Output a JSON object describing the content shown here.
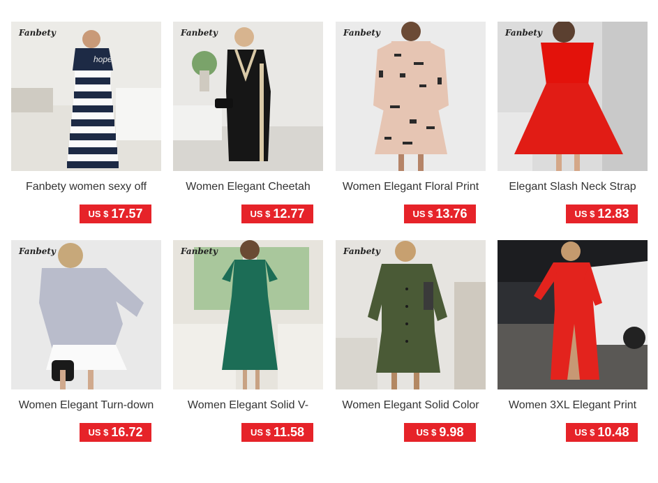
{
  "products": [
    {
      "brand": "Fanbety",
      "title": "Fanbety women sexy off",
      "currency": "US $",
      "price": "17.57",
      "image": "navy-striped-anchor-dress"
    },
    {
      "brand": "Fanbety",
      "title": "Women Elegant Cheetah",
      "currency": "US $",
      "price": "12.77",
      "image": "black-vneck-bodycon-dress"
    },
    {
      "brand": "Fanbety",
      "title": "Women Elegant Floral Print",
      "currency": "US $",
      "price": "13.76",
      "image": "letter-print-pink-dress"
    },
    {
      "brand": "Fanbety",
      "title": "Elegant Slash Neck Strap",
      "currency": "US $",
      "price": "12.83",
      "image": "red-off-shoulder-dress"
    },
    {
      "brand": "Fanbety",
      "title": "Women Elegant Turn-down",
      "currency": "US $",
      "price": "16.72",
      "image": "grey-sweatshirt-dress"
    },
    {
      "brand": "Fanbety",
      "title": "Women Elegant Solid V-",
      "currency": "US $",
      "price": "11.58",
      "image": "green-vneck-maxi-dress"
    },
    {
      "brand": "Fanbety",
      "title": "Women Elegant Solid Color",
      "currency": "US $",
      "price": "9.98",
      "image": "green-shirt-dress"
    },
    {
      "brand": "",
      "title": "Women 3XL Elegant Print",
      "currency": "US $",
      "price": "10.48",
      "image": "red-split-maxi-dress"
    }
  ],
  "colors": {
    "price_badge": "#e62329",
    "title_text": "#333333"
  }
}
